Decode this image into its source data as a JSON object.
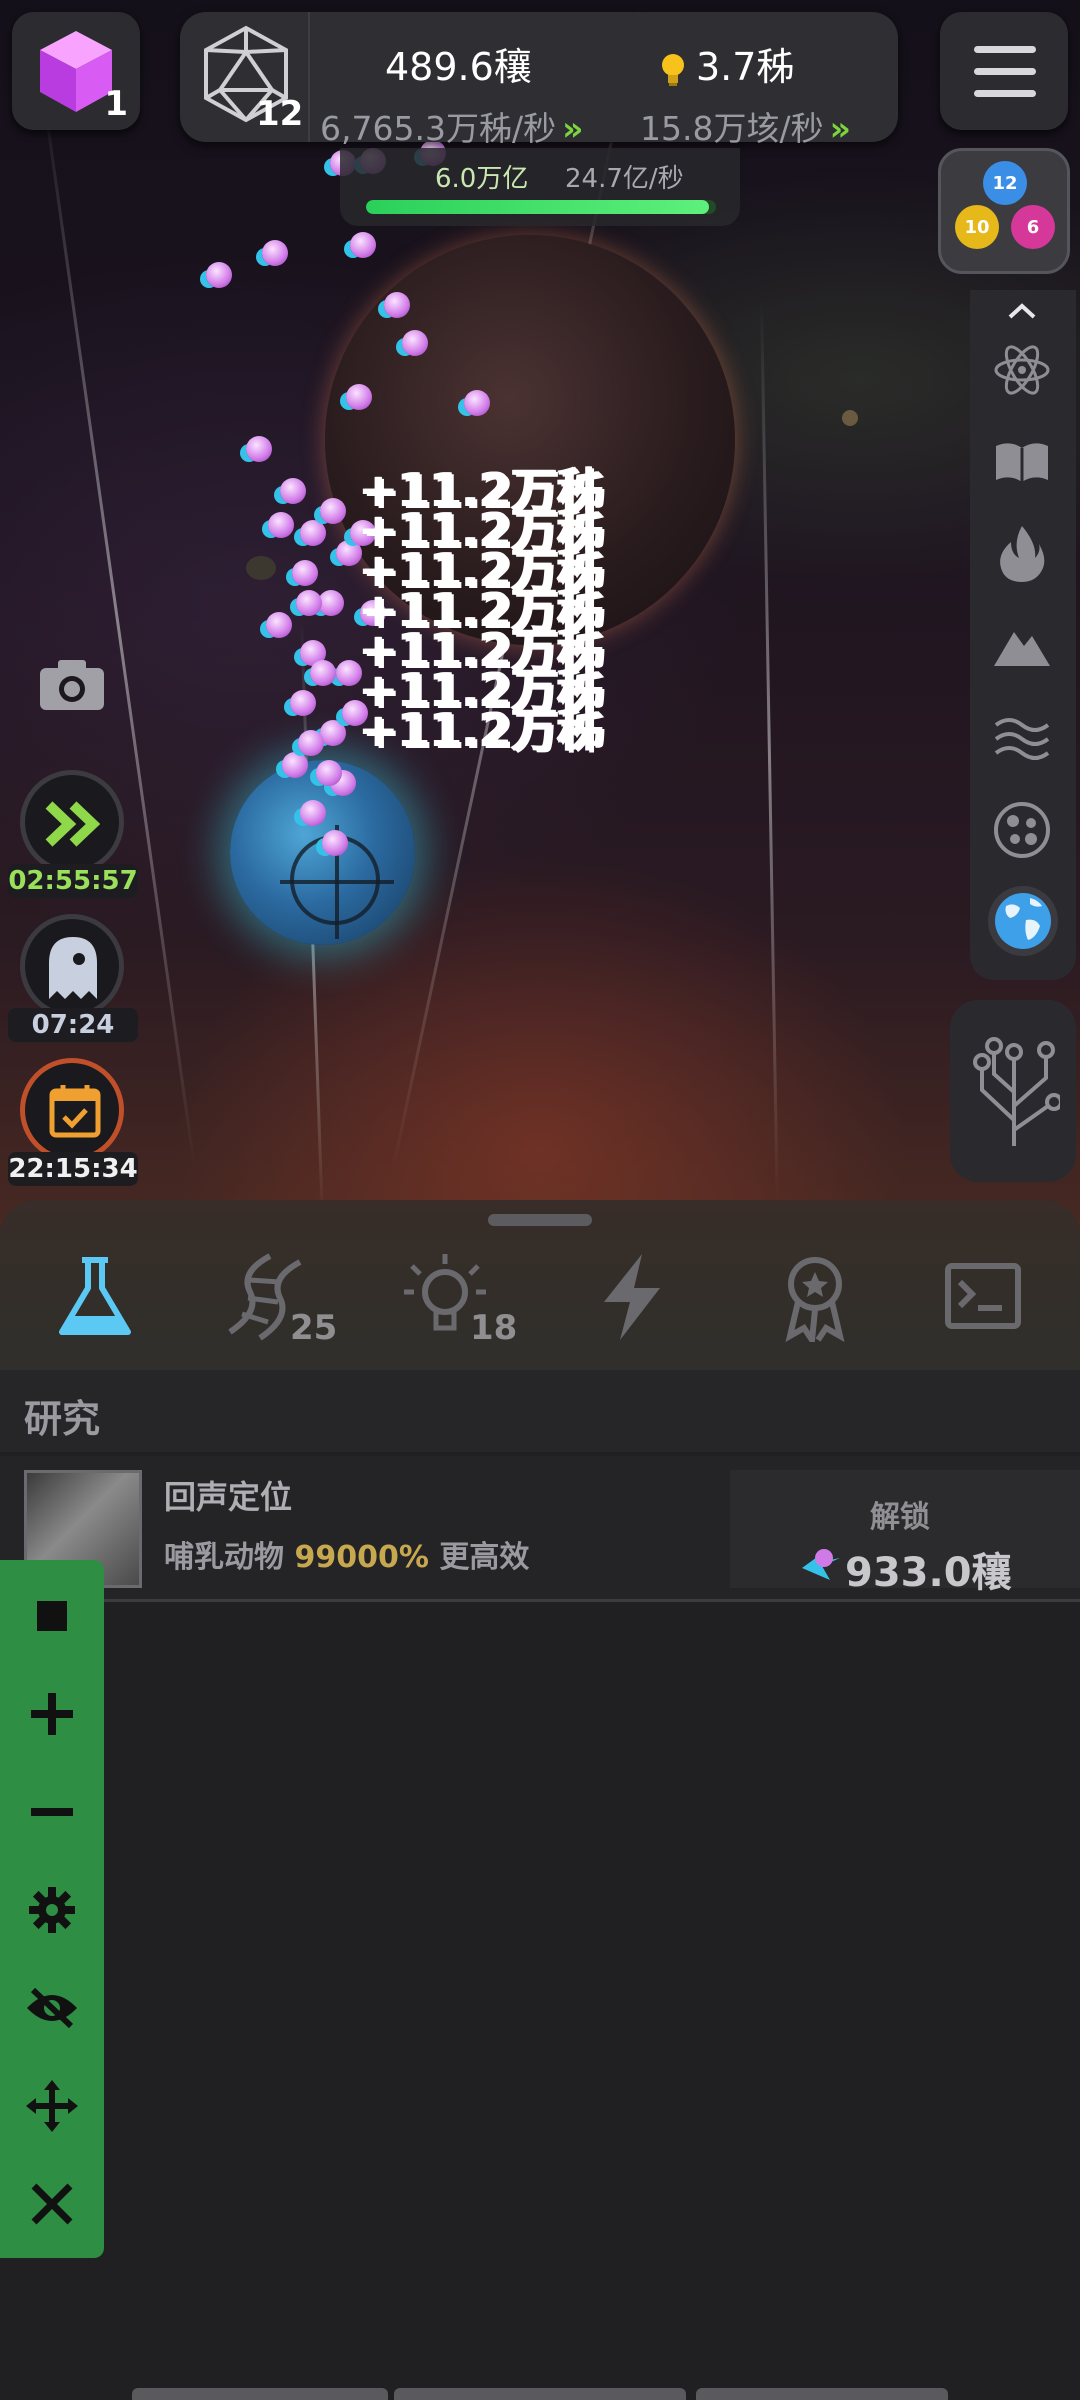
{
  "hud": {
    "cube_count": "1",
    "d20_count": "12",
    "resource_main": "489.6穰",
    "resource_bulb": "3.7秭",
    "rate_left": "6,765.3万秭/秒",
    "rate_right": "15.8万垓/秒",
    "sub_value": "6.0万亿",
    "sub_rate": "24.7亿/秒",
    "sub_progress": 0.98
  },
  "balls": [
    {
      "label": "12",
      "color": "#3a8ee6"
    },
    {
      "label": "10",
      "color": "#e6b81a"
    },
    {
      "label": "6",
      "color": "#d6389a"
    }
  ],
  "floating_text": "+11.2万秭",
  "timers": [
    {
      "value": "02:55:57",
      "color": "#9ae05a",
      "icon": "fast-forward-icon"
    },
    {
      "value": "07:24",
      "color": "#c8d0e0",
      "icon": "ghost-icon"
    },
    {
      "value": "22:15:34",
      "color": "#f0f0f0",
      "icon": "calendar-icon"
    }
  ],
  "right_rail": [
    "atom-icon",
    "book-icon",
    "flame-icon",
    "mountain-icon",
    "waves-icon",
    "cells-icon",
    "globe-icon"
  ],
  "tabs": [
    {
      "name": "flask-icon",
      "badge": ""
    },
    {
      "name": "dna-icon",
      "badge": "25"
    },
    {
      "name": "lightbulb-icon",
      "badge": "18"
    },
    {
      "name": "lightning-icon",
      "badge": ""
    },
    {
      "name": "award-icon",
      "badge": ""
    },
    {
      "name": "terminal-icon",
      "badge": ""
    }
  ],
  "section": {
    "title": "研究"
  },
  "research": {
    "name": "回声定位",
    "desc_prefix": "哺乳动物",
    "desc_pct": "99000%",
    "desc_suffix": "更高效",
    "unlock_label": "解锁",
    "unlock_cost": "933.0穰"
  },
  "green_toolbar": [
    "stop-icon",
    "plus-icon",
    "minus-icon",
    "gear-icon",
    "eye-off-icon",
    "move-icon",
    "close-icon"
  ],
  "colors": {
    "accent_green": "#2e8e44",
    "chevron_green": "#7cd43e",
    "progress_green": "#2ad05a"
  }
}
